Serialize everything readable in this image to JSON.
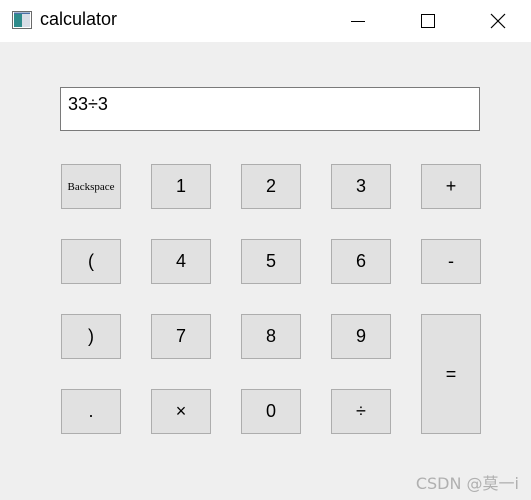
{
  "window": {
    "title": "calculator",
    "icon": "app-icon",
    "controls": [
      "minimize-icon",
      "maximize-icon",
      "close-icon"
    ]
  },
  "display": {
    "value": "33÷3"
  },
  "keys": {
    "backspace": "Backspace",
    "one": "1",
    "two": "2",
    "three": "3",
    "plus": "+",
    "lparen": "(",
    "four": "4",
    "five": "5",
    "six": "6",
    "minus": "-",
    "rparen": ")",
    "seven": "7",
    "eight": "8",
    "nine": "9",
    "equals": "=",
    "dot": ".",
    "times": "×",
    "zero": "0",
    "divide": "÷"
  },
  "watermark": "CSDN @莫一i",
  "colors": {
    "window_bg": "#efefef",
    "titlebar_bg": "#ffffff",
    "key_bg": "#e1e1e1",
    "key_border": "#adadad"
  }
}
